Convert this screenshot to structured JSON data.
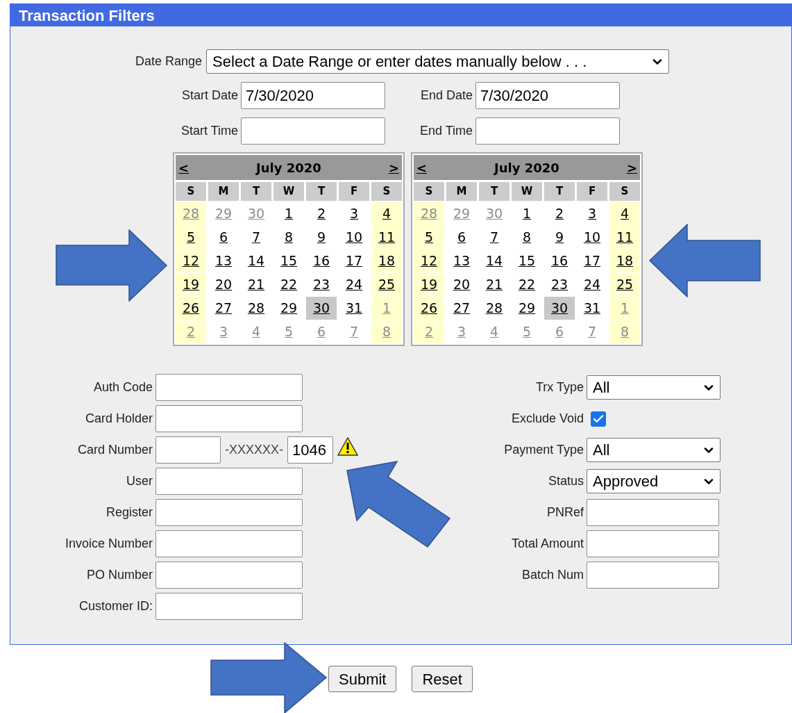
{
  "panel": {
    "title": "Transaction Filters"
  },
  "date_range": {
    "label": "Date Range",
    "value": "Select a Date Range or enter dates manually below . . ."
  },
  "date_fields": [
    {
      "label": "Start Date",
      "value": "7/30/2020"
    },
    {
      "label": "End Date",
      "value": "7/30/2020"
    },
    {
      "label": "Start Time"
    },
    {
      "label": "End Time"
    }
  ],
  "calendars": [
    {
      "prev": "<",
      "title": "July 2020",
      "next": ">",
      "weekdays": [
        "S",
        "M",
        "T",
        "W",
        "T",
        "F",
        "S"
      ],
      "weeks": [
        [
          {
            "day": "28",
            "other_month": true,
            "selected": false
          },
          {
            "day": "29",
            "other_month": true,
            "selected": false
          },
          {
            "day": "30",
            "other_month": true,
            "selected": false
          },
          {
            "day": "1",
            "other_month": false,
            "selected": false
          },
          {
            "day": "2",
            "other_month": false,
            "selected": false
          },
          {
            "day": "3",
            "other_month": false,
            "selected": false
          },
          {
            "day": "4",
            "other_month": false,
            "selected": false
          }
        ],
        [
          {
            "day": "5",
            "other_month": false,
            "selected": false
          },
          {
            "day": "6",
            "other_month": false,
            "selected": false
          },
          {
            "day": "7",
            "other_month": false,
            "selected": false
          },
          {
            "day": "8",
            "other_month": false,
            "selected": false
          },
          {
            "day": "9",
            "other_month": false,
            "selected": false
          },
          {
            "day": "10",
            "other_month": false,
            "selected": false
          },
          {
            "day": "11",
            "other_month": false,
            "selected": false
          }
        ],
        [
          {
            "day": "12",
            "other_month": false,
            "selected": false
          },
          {
            "day": "13",
            "other_month": false,
            "selected": false
          },
          {
            "day": "14",
            "other_month": false,
            "selected": false
          },
          {
            "day": "15",
            "other_month": false,
            "selected": false
          },
          {
            "day": "16",
            "other_month": false,
            "selected": false
          },
          {
            "day": "17",
            "other_month": false,
            "selected": false
          },
          {
            "day": "18",
            "other_month": false,
            "selected": false
          }
        ],
        [
          {
            "day": "19",
            "other_month": false,
            "selected": false
          },
          {
            "day": "20",
            "other_month": false,
            "selected": false
          },
          {
            "day": "21",
            "other_month": false,
            "selected": false
          },
          {
            "day": "22",
            "other_month": false,
            "selected": false
          },
          {
            "day": "23",
            "other_month": false,
            "selected": false
          },
          {
            "day": "24",
            "other_month": false,
            "selected": false
          },
          {
            "day": "25",
            "other_month": false,
            "selected": false
          }
        ],
        [
          {
            "day": "26",
            "other_month": false,
            "selected": false
          },
          {
            "day": "27",
            "other_month": false,
            "selected": false
          },
          {
            "day": "28",
            "other_month": false,
            "selected": false
          },
          {
            "day": "29",
            "other_month": false,
            "selected": false
          },
          {
            "day": "30",
            "other_month": false,
            "selected": true
          },
          {
            "day": "31",
            "other_month": false,
            "selected": false
          },
          {
            "day": "1",
            "other_month": true,
            "selected": false
          }
        ],
        [
          {
            "day": "2",
            "other_month": true,
            "selected": false
          },
          {
            "day": "3",
            "other_month": true,
            "selected": false
          },
          {
            "day": "4",
            "other_month": true,
            "selected": false
          },
          {
            "day": "5",
            "other_month": true,
            "selected": false
          },
          {
            "day": "6",
            "other_month": true,
            "selected": false
          },
          {
            "day": "7",
            "other_month": true,
            "selected": false
          },
          {
            "day": "8",
            "other_month": true,
            "selected": false
          }
        ]
      ]
    },
    {
      "prev": "<",
      "title": "July 2020",
      "next": ">",
      "weekdays": [
        "S",
        "M",
        "T",
        "W",
        "T",
        "F",
        "S"
      ],
      "weeks": [
        [
          {
            "day": "28",
            "other_month": true,
            "selected": false
          },
          {
            "day": "29",
            "other_month": true,
            "selected": false
          },
          {
            "day": "30",
            "other_month": true,
            "selected": false
          },
          {
            "day": "1",
            "other_month": false,
            "selected": false
          },
          {
            "day": "2",
            "other_month": false,
            "selected": false
          },
          {
            "day": "3",
            "other_month": false,
            "selected": false
          },
          {
            "day": "4",
            "other_month": false,
            "selected": false
          }
        ],
        [
          {
            "day": "5",
            "other_month": false,
            "selected": false
          },
          {
            "day": "6",
            "other_month": false,
            "selected": false
          },
          {
            "day": "7",
            "other_month": false,
            "selected": false
          },
          {
            "day": "8",
            "other_month": false,
            "selected": false
          },
          {
            "day": "9",
            "other_month": false,
            "selected": false
          },
          {
            "day": "10",
            "other_month": false,
            "selected": false
          },
          {
            "day": "11",
            "other_month": false,
            "selected": false
          }
        ],
        [
          {
            "day": "12",
            "other_month": false,
            "selected": false
          },
          {
            "day": "13",
            "other_month": false,
            "selected": false
          },
          {
            "day": "14",
            "other_month": false,
            "selected": false
          },
          {
            "day": "15",
            "other_month": false,
            "selected": false
          },
          {
            "day": "16",
            "other_month": false,
            "selected": false
          },
          {
            "day": "17",
            "other_month": false,
            "selected": false
          },
          {
            "day": "18",
            "other_month": false,
            "selected": false
          }
        ],
        [
          {
            "day": "19",
            "other_month": false,
            "selected": false
          },
          {
            "day": "20",
            "other_month": false,
            "selected": false
          },
          {
            "day": "21",
            "other_month": false,
            "selected": false
          },
          {
            "day": "22",
            "other_month": false,
            "selected": false
          },
          {
            "day": "23",
            "other_month": false,
            "selected": false
          },
          {
            "day": "24",
            "other_month": false,
            "selected": false
          },
          {
            "day": "25",
            "other_month": false,
            "selected": false
          }
        ],
        [
          {
            "day": "26",
            "other_month": false,
            "selected": false
          },
          {
            "day": "27",
            "other_month": false,
            "selected": false
          },
          {
            "day": "28",
            "other_month": false,
            "selected": false
          },
          {
            "day": "29",
            "other_month": false,
            "selected": false
          },
          {
            "day": "30",
            "other_month": false,
            "selected": true
          },
          {
            "day": "31",
            "other_month": false,
            "selected": false
          },
          {
            "day": "1",
            "other_month": true,
            "selected": false
          }
        ],
        [
          {
            "day": "2",
            "other_month": true,
            "selected": false
          },
          {
            "day": "3",
            "other_month": true,
            "selected": false
          },
          {
            "day": "4",
            "other_month": true,
            "selected": false
          },
          {
            "day": "5",
            "other_month": true,
            "selected": false
          },
          {
            "day": "6",
            "other_month": true,
            "selected": false
          },
          {
            "day": "7",
            "other_month": true,
            "selected": false
          },
          {
            "day": "8",
            "other_month": true,
            "selected": false
          }
        ]
      ]
    }
  ],
  "left_fields": [
    {
      "label": "Auth Code",
      "kind": "text"
    },
    {
      "label": "Card Holder",
      "kind": "text"
    },
    {
      "label": "Card Number",
      "kind": "card",
      "separator": "-XXXXXX-",
      "value": "1046",
      "warning": true
    },
    {
      "label": "User",
      "kind": "text"
    },
    {
      "label": "Register",
      "kind": "text"
    },
    {
      "label": "Invoice Number",
      "kind": "text"
    },
    {
      "label": "PO Number",
      "kind": "text"
    },
    {
      "label": "Customer ID:",
      "kind": "text"
    }
  ],
  "right_fields": [
    {
      "label": "Trx Type",
      "kind": "select",
      "value": "All"
    },
    {
      "label": "Exclude Void",
      "kind": "checkbox",
      "checked": true
    },
    {
      "label": "Payment Type",
      "kind": "select",
      "value": "All"
    },
    {
      "label": "Status",
      "kind": "select",
      "value": "Approved"
    },
    {
      "label": "PNRef",
      "kind": "text"
    },
    {
      "label": "Total Amount",
      "kind": "text"
    },
    {
      "label": "Batch Num",
      "kind": "text"
    }
  ],
  "buttons": [
    "Submit",
    "Reset"
  ]
}
